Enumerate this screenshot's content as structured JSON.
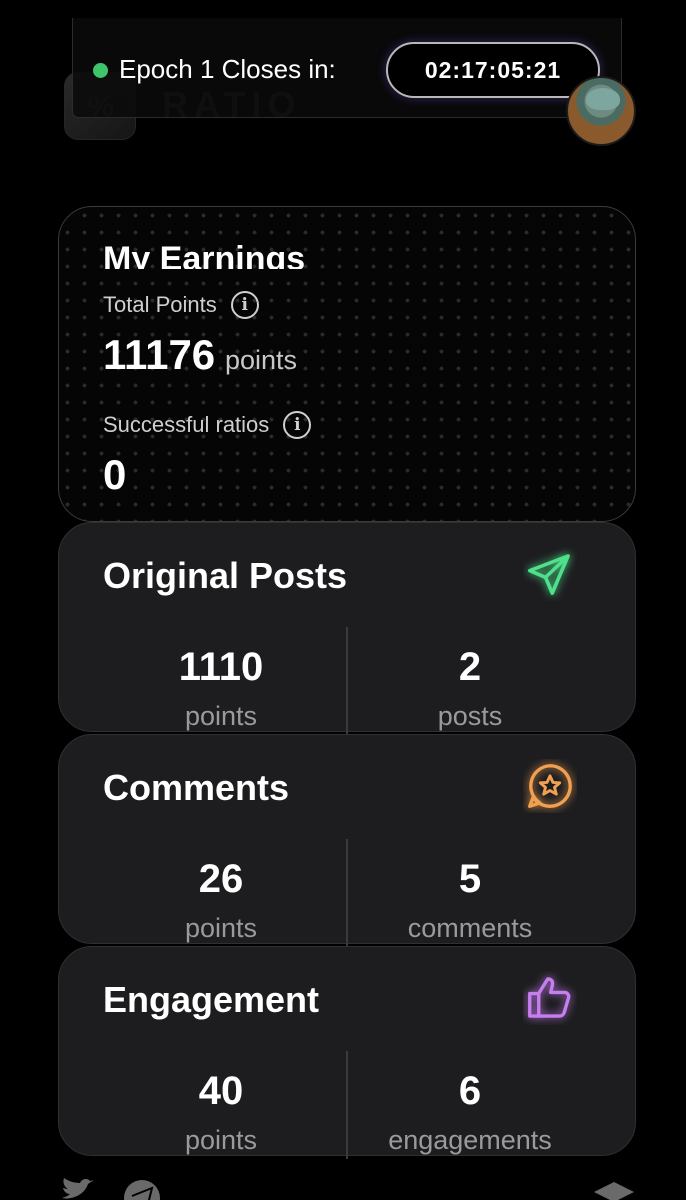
{
  "header": {
    "epoch_label": "Epoch 1 Closes in:",
    "countdown": "02:17:05:21",
    "logo_text": "RATIO",
    "status_color": "#3ec56b"
  },
  "earnings": {
    "title": "My Earnings",
    "total_points_label": "Total Points",
    "total_points_value": "11176",
    "total_points_unit": "points",
    "successful_ratios_label": "Successful ratios",
    "successful_ratios_value": "0"
  },
  "cards": [
    {
      "title": "Original Posts",
      "icon": "paper-plane-icon",
      "icon_color": "#4ee08a",
      "left_value": "1110",
      "left_label": "points",
      "right_value": "2",
      "right_label": "posts"
    },
    {
      "title": "Comments",
      "icon": "star-chat-bubble-icon",
      "icon_color": "#f0a050",
      "left_value": "26",
      "left_label": "points",
      "right_value": "5",
      "right_label": "comments"
    },
    {
      "title": "Engagement",
      "icon": "thumbs-up-icon",
      "icon_color": "#c77ef0",
      "left_value": "40",
      "left_label": "points",
      "right_value": "6",
      "right_label": "engagements"
    }
  ],
  "footer": {
    "icons": [
      "twitter-icon",
      "telegram-icon",
      "docs-icon"
    ]
  }
}
